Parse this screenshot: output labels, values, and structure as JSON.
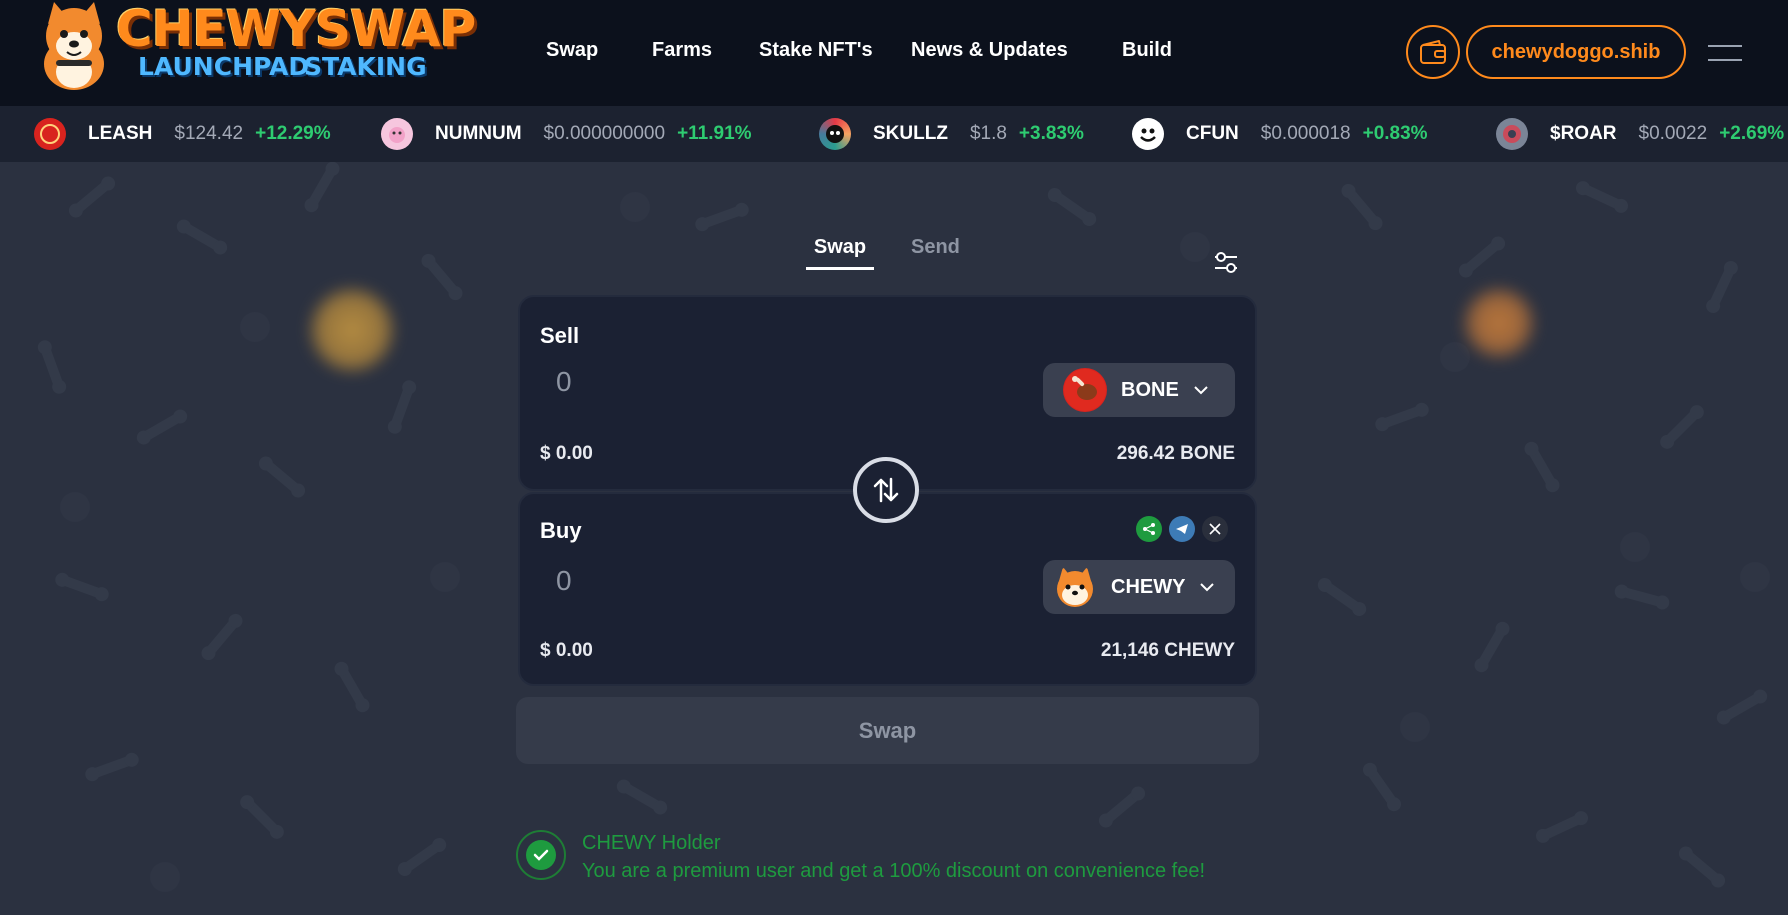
{
  "brand": {
    "name": "CHEWYSWAP",
    "sub1": "LAUNCHPAD",
    "sub2": "STAKING"
  },
  "nav": {
    "items": [
      "Swap",
      "Farms",
      "Stake NFT's",
      "News & Updates",
      "Build"
    ]
  },
  "header": {
    "account_label": "chewydoggo.shib"
  },
  "ticker": [
    {
      "symbol": "LEASH",
      "price": "$124.42",
      "change": "+12.29%"
    },
    {
      "symbol": "NUMNUM",
      "price": "$0.000000000",
      "change": "+11.91%"
    },
    {
      "symbol": "SKULLZ",
      "price": "$1.8",
      "change": "+3.83%"
    },
    {
      "symbol": "CFUN",
      "price": "$0.000018",
      "change": "+0.83%"
    },
    {
      "symbol": "$ROAR",
      "price": "$0.0022",
      "change": "+2.69%"
    }
  ],
  "tabs": {
    "swap": "Swap",
    "send": "Send"
  },
  "sell": {
    "label": "Sell",
    "placeholder": "0",
    "usd_value": "$ 0.00",
    "token": "BONE",
    "balance": "296.42 BONE"
  },
  "buy": {
    "label": "Buy",
    "placeholder": "0",
    "usd_value": "$ 0.00",
    "token": "CHEWY",
    "balance": "21,146 CHEWY"
  },
  "action": {
    "swap_label": "Swap"
  },
  "holder": {
    "title": "CHEWY Holder",
    "message": "You are a premium user and get a 100% discount on convenience fee!"
  },
  "colors": {
    "accent": "#ff8a1c",
    "positive": "#2ecc71",
    "holder_green": "#1e9b3f",
    "background": "#2b3140",
    "panel": "#1b2133"
  },
  "icons": {
    "wallet": "wallet-icon",
    "menu": "hamburger-menu-icon",
    "settings": "sliders-settings-icon",
    "flip": "swap-direction-arrows-icon",
    "chevron": "chevron-down-icon",
    "check": "check-icon",
    "share": "share-icon",
    "telegram": "telegram-icon",
    "x": "x-twitter-icon"
  }
}
